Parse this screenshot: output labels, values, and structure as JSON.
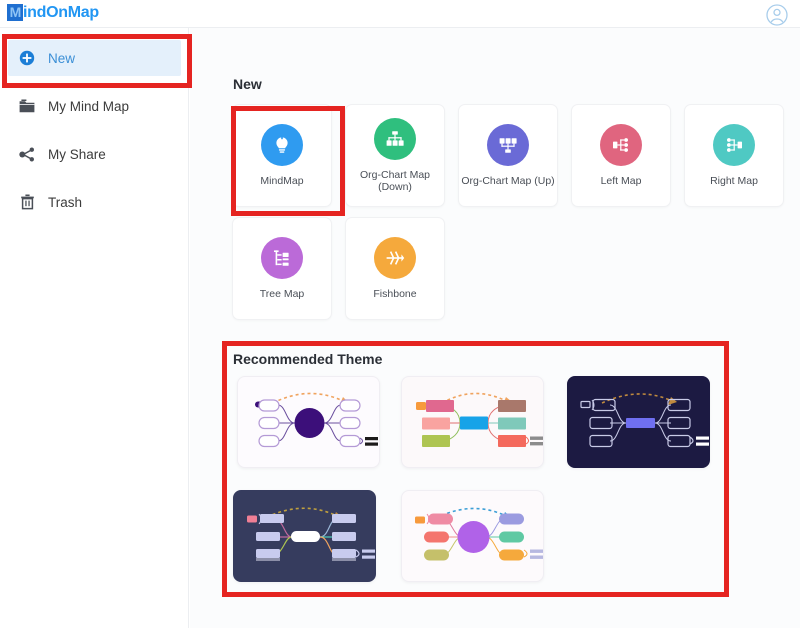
{
  "app": {
    "brand_initial": "M",
    "brand_name": "indOnMap",
    "brand_color": "#2196f3",
    "avatar_icon": "user-circle-icon"
  },
  "sidebar": {
    "items": [
      {
        "label": "New",
        "icon": "plus-circle-icon",
        "active": true
      },
      {
        "label": "My Mind Map",
        "icon": "folder-icon",
        "active": false
      },
      {
        "label": "My Share",
        "icon": "share-icon",
        "active": false
      },
      {
        "label": "Trash",
        "icon": "trash-icon",
        "active": false
      }
    ]
  },
  "main": {
    "new_section": {
      "title": "New",
      "cards": [
        {
          "label": "MindMap",
          "icon": "lightbulb-icon",
          "color": "#2f9bf0",
          "selected": true
        },
        {
          "label": "Org-Chart Map (Down)",
          "icon": "org-down-icon",
          "color": "#2fbf7e",
          "selected": false
        },
        {
          "label": "Org-Chart Map (Up)",
          "icon": "org-up-icon",
          "color": "#6a6ad6",
          "selected": false
        },
        {
          "label": "Left Map",
          "icon": "left-map-icon",
          "color": "#e0657f",
          "selected": false
        },
        {
          "label": "Right Map",
          "icon": "right-map-icon",
          "color": "#4fc9c3",
          "selected": false
        },
        {
          "label": "Tree Map",
          "icon": "tree-map-icon",
          "color": "#b濃",
          "selected": false
        },
        {
          "label": "Fishbone",
          "icon": "fishbone-icon",
          "color": "#f5a93c",
          "selected": false
        }
      ]
    },
    "recommended_section": {
      "title": "Recommended Theme",
      "themes": [
        {
          "name": "theme-light-purple",
          "background": "#fdfbfe",
          "center_color": "#3c0f7a",
          "node_style": "outline-pill",
          "arrow_color": "#f0a35e"
        },
        {
          "name": "theme-colorful",
          "background": "#fcf9fa",
          "center_color": "#17a3e8",
          "node_style": "filled-rect",
          "arrow_color": "#f0a35e"
        },
        {
          "name": "theme-dark-navy",
          "background": "#1c1a42",
          "center_color": "#6f6ff0",
          "node_style": "outline-rect",
          "arrow_color": "#c08a3e"
        },
        {
          "name": "theme-dark-slate",
          "background": "#363c5e",
          "center_color": "#ffffff",
          "node_style": "filled-pill",
          "arrow_color": "#c08a3e"
        },
        {
          "name": "theme-light-violet",
          "background": "#fdfafc",
          "center_color": "#b062e8",
          "node_style": "filled-pill",
          "arrow_color": "#3c9fd6"
        }
      ]
    }
  },
  "annotations": {
    "color": "#e52421",
    "boxes": [
      {
        "name": "annotation-new-nav"
      },
      {
        "name": "annotation-mindmap"
      },
      {
        "name": "annotation-themes"
      }
    ]
  }
}
